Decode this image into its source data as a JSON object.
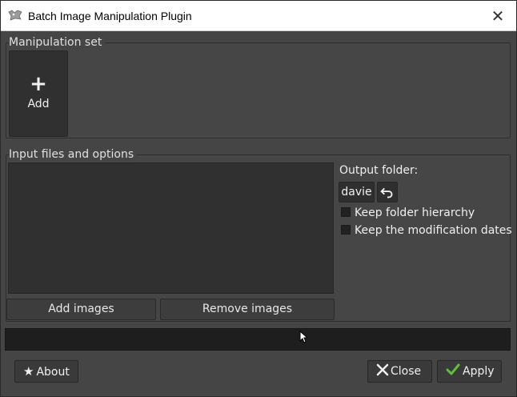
{
  "window": {
    "title": "Batch Image Manipulation Plugin",
    "close_glyph": "✕"
  },
  "manipulation_set": {
    "title": "Manipulation set",
    "add_label": "Add",
    "add_glyph": "+"
  },
  "input": {
    "title": "Input files and options",
    "add_images_label": "Add images",
    "remove_images_label": "Remove images",
    "output_folder_label": "Output folder:",
    "output_folder_value": "davie",
    "keep_hierarchy_label": "Keep folder hierarchy",
    "keep_hierarchy_checked": false,
    "keep_dates_label": "Keep the modification dates",
    "keep_dates_checked": false
  },
  "footer": {
    "about_label": "About",
    "close_label": "Close",
    "apply_label": "Apply"
  },
  "colors": {
    "dialog_bg": "#454545",
    "apply_check": "#5fbf3a"
  }
}
